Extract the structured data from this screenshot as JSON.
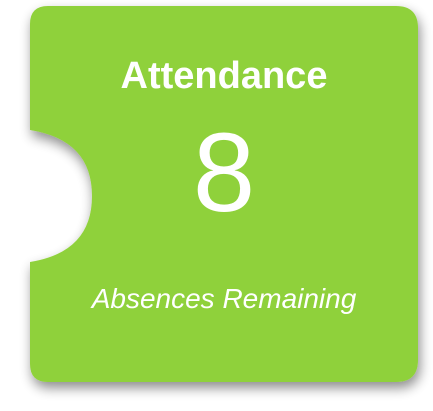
{
  "tile": {
    "title": "Attendance",
    "value": "8",
    "caption": "Absences Remaining",
    "colors": {
      "background": "#8fd13a",
      "text": "#ffffff",
      "shadow": "#555555"
    }
  }
}
